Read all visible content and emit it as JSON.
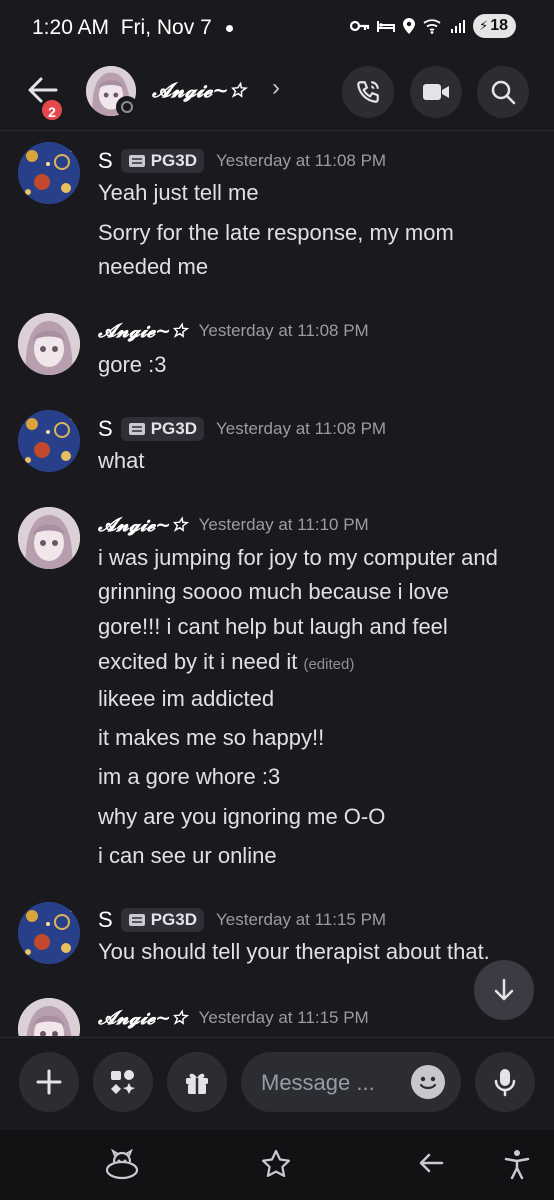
{
  "status_bar": {
    "time": "1:20 AM",
    "date": "Fri, Nov 7",
    "battery": "18"
  },
  "header": {
    "back_badge": "2",
    "contact_name": "𝓐𝓷𝓰𝓲𝓮~☆",
    "chevron": "›"
  },
  "messages": [
    {
      "author": "S",
      "tag": "PG3D",
      "timestamp": "Yesterday at 11:08 PM",
      "avatar": "galaxy-avatar",
      "lines": [
        "Yeah just tell me",
        "Sorry for the late response, my mom",
        "needed me"
      ]
    },
    {
      "author": "𝓐𝓷𝓰𝓲𝓮~☆",
      "timestamp": "Yesterday at 11:08 PM",
      "avatar": "anime-avatar",
      "lines": [
        "gore :3"
      ]
    },
    {
      "author": "S",
      "tag": "PG3D",
      "timestamp": "Yesterday at 11:08 PM",
      "avatar": "galaxy-avatar",
      "lines": [
        "what"
      ]
    },
    {
      "author": "𝓐𝓷𝓰𝓲𝓮~☆",
      "timestamp": "Yesterday at 11:10 PM",
      "avatar": "anime-avatar",
      "lines": [
        "i was jumping for joy to my computer and",
        "grinning soooo much because i love",
        "gore!!! i cant help but laugh and feel",
        "excited by it i need it",
        "likeee im addicted",
        "it makes me so happy!!",
        "im a gore whore :3",
        "why are you ignoring me O-O",
        "i can see ur online"
      ],
      "edited_label": "(edited)"
    },
    {
      "author": "S",
      "tag": "PG3D",
      "timestamp": "Yesterday at 11:15 PM",
      "avatar": "galaxy-avatar",
      "lines": [
        "You should tell your therapist about that."
      ]
    },
    {
      "author": "𝓐𝓷𝓰𝓲𝓮~☆",
      "timestamp": "Yesterday at 11:15 PM",
      "avatar": "anime-avatar",
      "lines": []
    }
  ],
  "composer": {
    "placeholder": "Message ..."
  },
  "colors": {
    "background": "#1a1a1e",
    "accent_badge": "#e5484d",
    "galaxy_blue": "#2a3e86"
  }
}
